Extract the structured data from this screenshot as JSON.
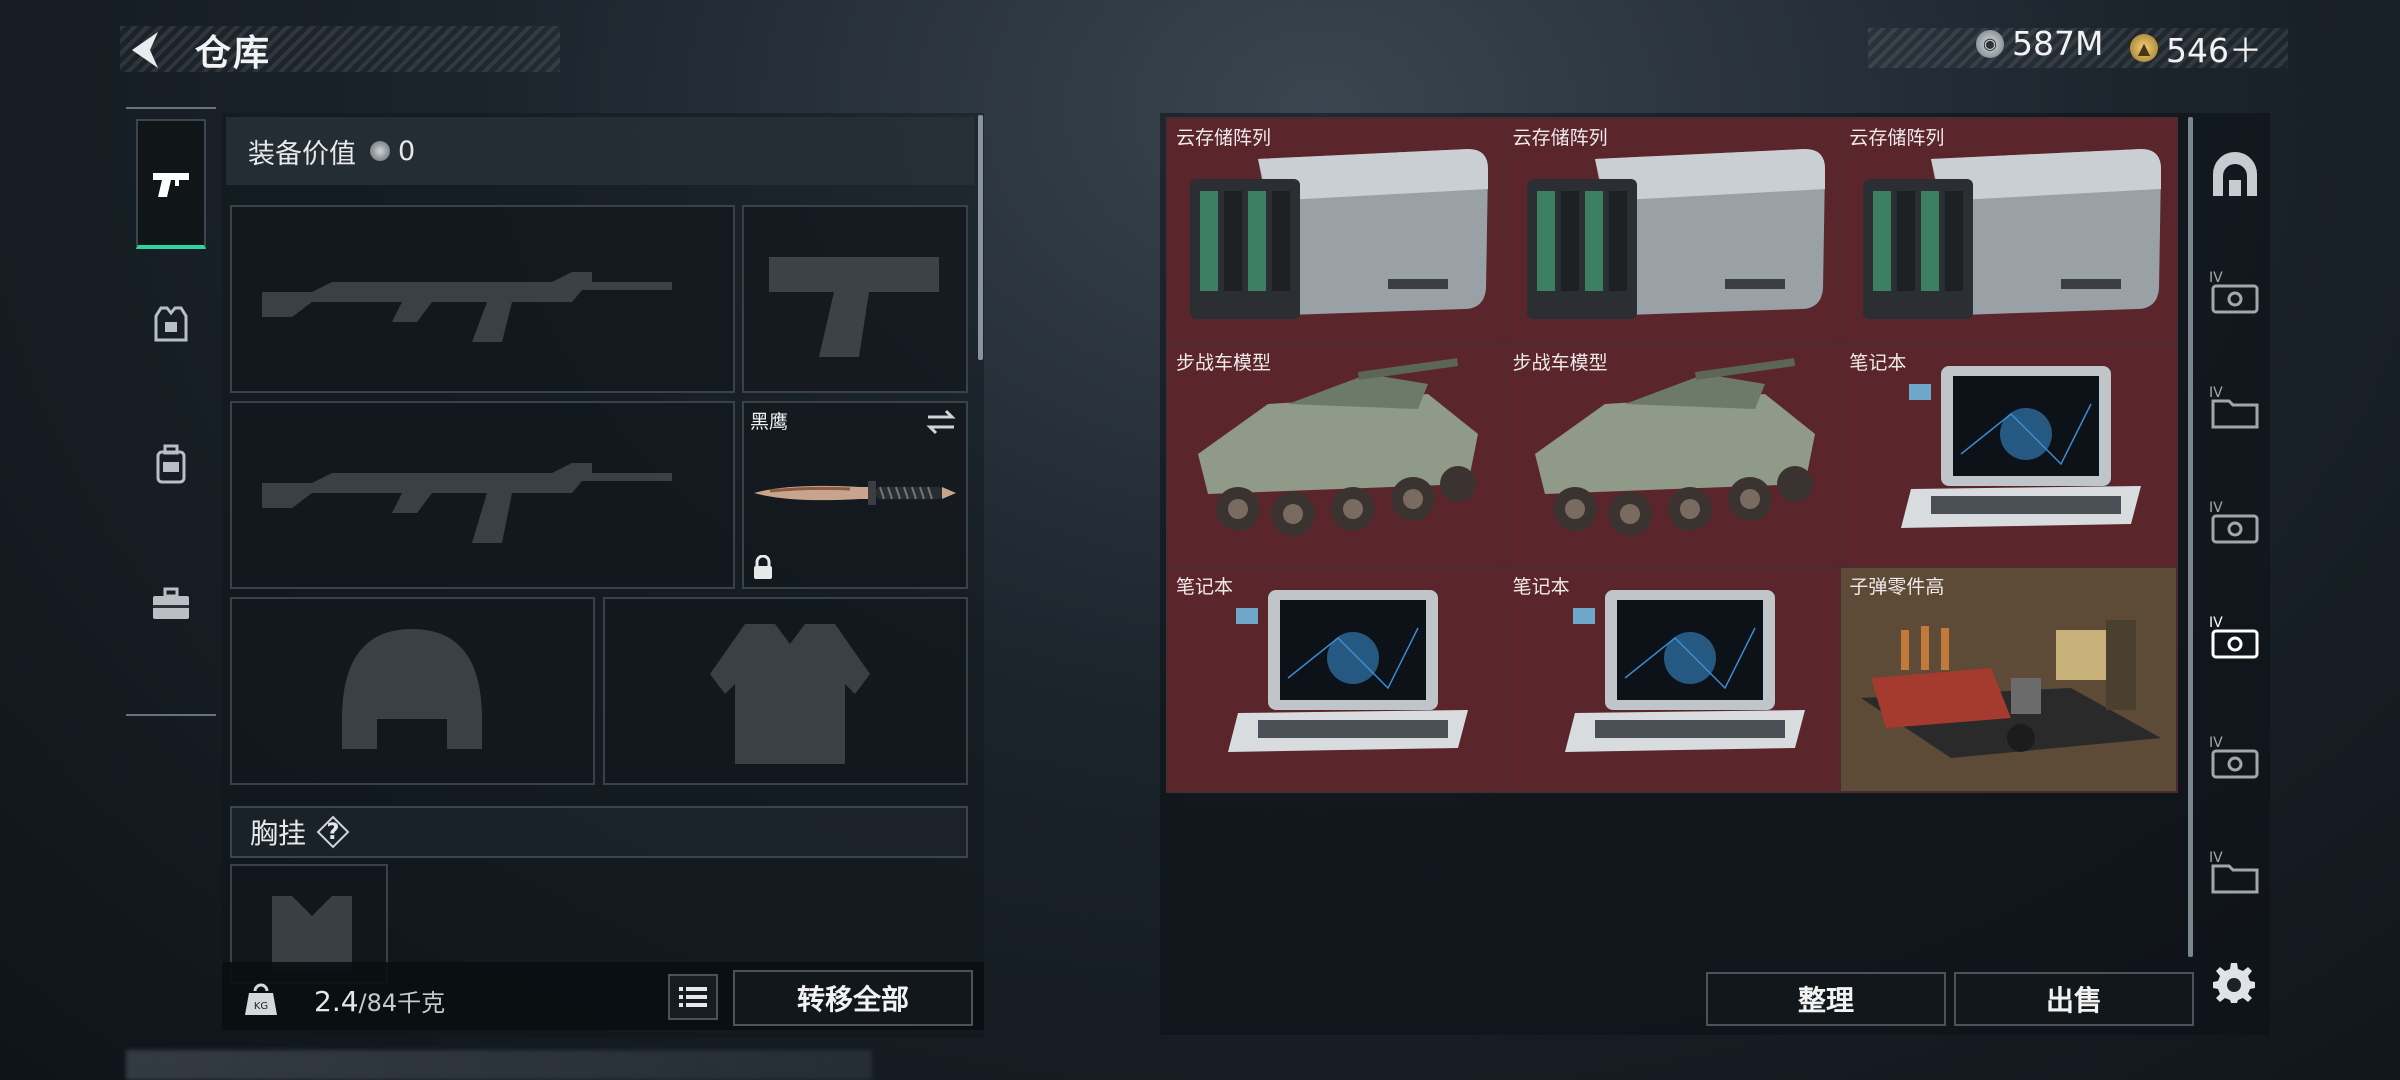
{
  "header": {
    "title": "仓库",
    "currency": [
      {
        "icon": "silver-coin-icon",
        "value": "587M"
      },
      {
        "icon": "gold-coin-icon",
        "value": "546＋"
      }
    ]
  },
  "left_tabs": [
    {
      "icon": "pistol-icon",
      "active": true
    },
    {
      "icon": "armor-vest-icon",
      "active": false
    },
    {
      "icon": "backpack-icon",
      "active": false
    },
    {
      "icon": "toolbox-icon",
      "active": false
    }
  ],
  "equipment": {
    "value_label": "装备价值",
    "value_icon": "silver-coin-icon",
    "value": "0",
    "slots": [
      {
        "id": "primary-weapon-1",
        "silhouette": "rifle-icon"
      },
      {
        "id": "pistol",
        "silhouette": "pistol-icon"
      },
      {
        "id": "primary-weapon-2",
        "silhouette": "rifle-icon"
      },
      {
        "id": "melee",
        "item_name": "黑鹰",
        "locked": true
      },
      {
        "id": "helmet",
        "silhouette": "helmet-icon"
      },
      {
        "id": "body-armor",
        "silhouette": "body-armor-icon"
      }
    ],
    "chest_rig_label": "胸挂",
    "chest_rig_help": "?",
    "weight_current": "2.4",
    "weight_max": "/84千克",
    "transfer_all_label": "转移全部"
  },
  "storage": {
    "items": [
      {
        "name": "云存储阵列",
        "kind": "storage-array",
        "color": "red"
      },
      {
        "name": "云存储阵列",
        "kind": "storage-array",
        "color": "red"
      },
      {
        "name": "云存储阵列",
        "kind": "storage-array",
        "color": "red"
      },
      {
        "name": "步战车模型",
        "kind": "ifv-model",
        "color": "red"
      },
      {
        "name": "步战车模型",
        "kind": "ifv-model",
        "color": "red"
      },
      {
        "name": "笔记本",
        "kind": "laptop",
        "color": "red"
      },
      {
        "name": "笔记本",
        "kind": "laptop",
        "color": "red"
      },
      {
        "name": "笔记本",
        "kind": "laptop",
        "color": "red"
      },
      {
        "name": "子弹零件高",
        "kind": "ammo-parts",
        "color": "gold"
      }
    ],
    "arrange_label": "整理",
    "sell_label": "出售"
  },
  "right_rail": [
    {
      "icon": "arch-icon",
      "active": false
    },
    {
      "icon": "tier-iv-case-icon",
      "label": "IV",
      "active": false
    },
    {
      "icon": "tier-iv-folder-icon",
      "label": "IV",
      "active": false
    },
    {
      "icon": "tier-iv-case-icon",
      "label": "IV",
      "active": false
    },
    {
      "icon": "tier-iv-case-icon",
      "label": "IV",
      "active": true
    },
    {
      "icon": "tier-iv-case-icon",
      "label": "IV",
      "active": false
    },
    {
      "icon": "tier-iv-folder-icon",
      "label": "IV",
      "active": false
    }
  ]
}
